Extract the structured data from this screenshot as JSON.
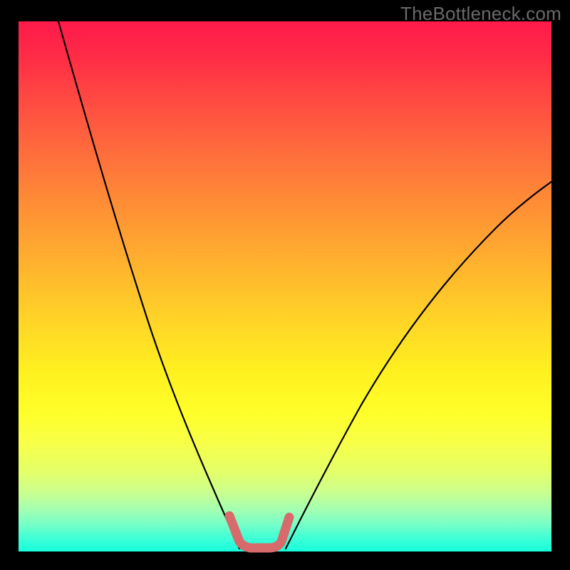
{
  "watermark": "TheBottleneck.com",
  "colors": {
    "background": "#000000",
    "gradient_top": "#ff1a4a",
    "gradient_bottom": "#16ffdc",
    "curve_stroke": "#000000",
    "highlight_stroke": "#d76a6a"
  },
  "chart_data": {
    "type": "line",
    "title": "",
    "xlabel": "",
    "ylabel": "",
    "xlim": [
      0,
      100
    ],
    "ylim": [
      0,
      100
    ],
    "description": "V-shaped bottleneck curve with color gradient from red (high bottleneck) to green (no bottleneck). A short salmon highlight lies at the valley floor.",
    "series": [
      {
        "name": "bottleneck-left-branch",
        "x": [
          7.5,
          10,
          13,
          16,
          19,
          22,
          25,
          28,
          31,
          34,
          37,
          39.5,
          41.5
        ],
        "y": [
          100,
          88,
          75,
          63,
          52,
          42,
          33,
          25,
          18,
          12,
          7,
          3,
          0.5
        ]
      },
      {
        "name": "bottleneck-right-branch",
        "x": [
          50,
          53,
          57,
          62,
          68,
          74,
          80,
          86,
          92,
          98,
          100
        ],
        "y": [
          0.5,
          5,
          12,
          21,
          31,
          40,
          48,
          55,
          61,
          66,
          68
        ]
      },
      {
        "name": "highlight-segment",
        "x": [
          39.5,
          41.5,
          43.5,
          47,
          49,
          50.5
        ],
        "y": [
          7,
          2,
          0.8,
          0.8,
          2,
          7
        ]
      }
    ]
  }
}
